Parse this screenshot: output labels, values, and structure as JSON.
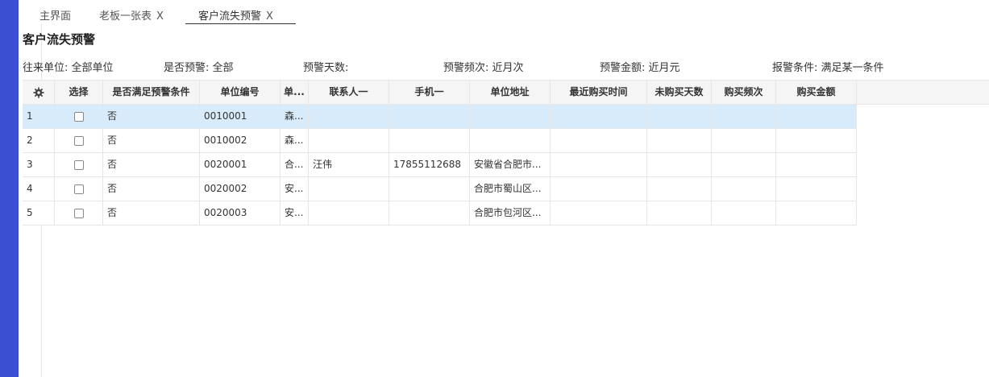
{
  "tabs": [
    {
      "label": "主界面",
      "closable": false
    },
    {
      "label": "老板一张表",
      "closable": true
    },
    {
      "label": "客户流失预警",
      "closable": true,
      "active": true
    }
  ],
  "tab_close_glyph": "X",
  "page": {
    "title": "客户流失预警"
  },
  "filters": [
    {
      "label": "往来单位:",
      "value": "全部单位"
    },
    {
      "label": "是否预警:",
      "value": "全部"
    },
    {
      "label": "预警天数:",
      "value": ""
    },
    {
      "label": "预警频次:",
      "value": "近月次"
    },
    {
      "label": "预警金额:",
      "value": "近月元"
    },
    {
      "label": "报警条件:",
      "value": "满足某一条件"
    }
  ],
  "table": {
    "settings_icon": "gear-icon",
    "columns": [
      "选择",
      "是否满足预警条件",
      "单位编号",
      "单...",
      "联系人一",
      "手机一",
      "单位地址",
      "最近购买时间",
      "未购买天数",
      "购买频次",
      "购买金额"
    ],
    "rows": [
      {
        "index": "1",
        "checked": false,
        "warn": "否",
        "code": "0010001",
        "name": "森...",
        "contact": "",
        "phone": "",
        "address": "",
        "last_buy": "",
        "days": "",
        "freq": "",
        "amount": ""
      },
      {
        "index": "2",
        "checked": false,
        "warn": "否",
        "code": "0010002",
        "name": "森...",
        "contact": "",
        "phone": "",
        "address": "",
        "last_buy": "",
        "days": "",
        "freq": "",
        "amount": ""
      },
      {
        "index": "3",
        "checked": false,
        "warn": "否",
        "code": "0020001",
        "name": "合...",
        "contact": "汪伟",
        "phone": "17855112688",
        "address": "安徽省合肥市...",
        "last_buy": "",
        "days": "",
        "freq": "",
        "amount": ""
      },
      {
        "index": "4",
        "checked": false,
        "warn": "否",
        "code": "0020002",
        "name": "安...",
        "contact": "",
        "phone": "",
        "address": "合肥市蜀山区...",
        "last_buy": "",
        "days": "",
        "freq": "",
        "amount": ""
      },
      {
        "index": "5",
        "checked": false,
        "warn": "否",
        "code": "0020003",
        "name": "安...",
        "contact": "",
        "phone": "",
        "address": "合肥市包河区...",
        "last_buy": "",
        "days": "",
        "freq": "",
        "amount": ""
      }
    ],
    "selected_row": 0
  },
  "colors": {
    "sidebar": "#3b4fd3",
    "selected_row": "#d8ebfb",
    "header_bg": "#f5f5f5"
  }
}
